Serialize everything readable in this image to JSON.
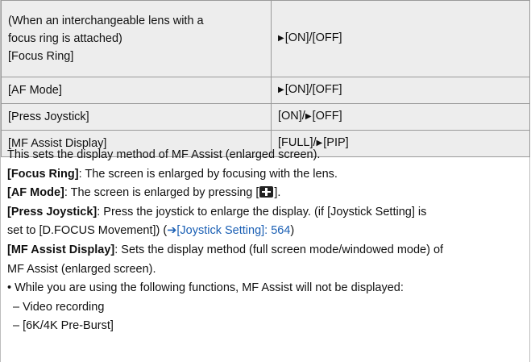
{
  "table": {
    "rows": [
      {
        "label_lines": [
          "(When an interchangeable lens with a",
          "focus ring is attached)",
          "[Focus Ring]"
        ],
        "value_arrow": "▶",
        "value": "[ON]/[OFF]"
      },
      {
        "label": "[AF Mode]",
        "value_arrow": "▶",
        "value": "[ON]/[OFF]"
      },
      {
        "label": "[Press Joystick]",
        "value_pre": "[ON]/",
        "value_arrow": "▶",
        "value": "[OFF]"
      },
      {
        "label": "[MF Assist Display]",
        "value_pre": "[FULL]/",
        "value_arrow": "▶",
        "value": "[PIP]"
      }
    ]
  },
  "description": {
    "intro": "This sets the display method of MF Assist (enlarged screen).",
    "focus_ring_term": "[Focus Ring]",
    "focus_ring_text": ": The screen is enlarged by focusing with the lens.",
    "af_mode_term": "[AF Mode]",
    "af_mode_text_pre": ": The screen is enlarged by pressing [",
    "af_mode_icon": "af-mode-button-icon",
    "af_mode_text_post": "].",
    "press_joystick_term": "[Press Joystick]",
    "press_joystick_text1": ": Press the joystick to enlarge the display. (if [Joystick Setting] is",
    "press_joystick_text2": "set to [D.FOCUS Movement]) (",
    "press_joystick_arrow": "➔",
    "press_joystick_link": "[Joystick Setting]: 564",
    "press_joystick_close": ")",
    "mf_assist_term": "[MF Assist Display]",
    "mf_assist_text1": ": Sets the display method (full screen mode/windowed mode) of",
    "mf_assist_text2": "MF Assist (enlarged screen).",
    "note_bullet": "•",
    "note_text": "While you are using the following functions, MF Assist will not be displayed:",
    "sub_items": [
      "– Video recording",
      "– [6K/4K Pre-Burst]"
    ]
  },
  "colors": {
    "table_bg": "#ededed",
    "border": "#9a9a9a",
    "link": "#1a5fb4"
  }
}
